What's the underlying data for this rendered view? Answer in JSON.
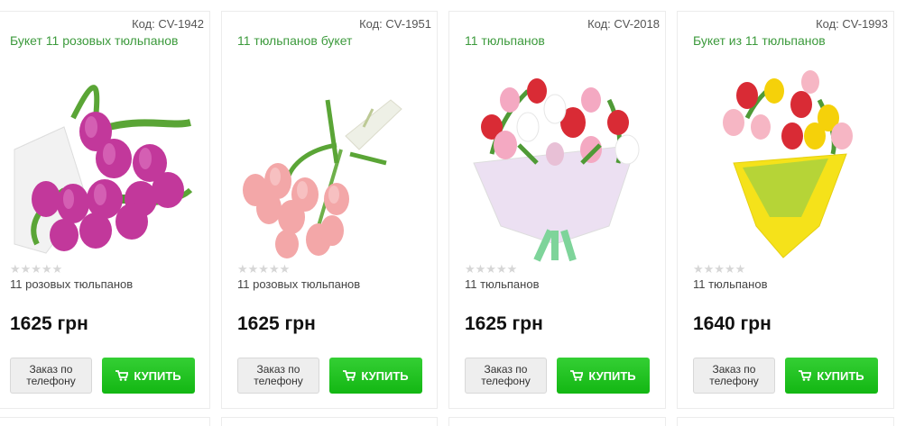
{
  "products": [
    {
      "code": "Код: CV-1942",
      "title": "Букет 11 розовых тюльпанов",
      "stars": "★★★★★",
      "subtitle": "11 розовых тюльпанов",
      "price": "1625 грн",
      "phone_label": "Заказ по телефону",
      "buy_label": "КУПИТЬ",
      "image": "pink-tulips-bouquet"
    },
    {
      "code": "Код: CV-1951",
      "title": "11 тюльпанов букет",
      "stars": "★★★★★",
      "subtitle": "11 розовых тюльпанов",
      "price": "1625 грн",
      "phone_label": "Заказ по телефону",
      "buy_label": "КУПИТЬ",
      "image": "light-pink-tulips-bouquet"
    },
    {
      "code": "Код: CV-2018",
      "title": "11 тюльпанов",
      "stars": "★★★★★",
      "subtitle": "11 тюльпанов",
      "price": "1625 грн",
      "phone_label": "Заказ по телефону",
      "buy_label": "КУПИТЬ",
      "image": "mixed-tulips-white-wrap"
    },
    {
      "code": "Код: CV-1993",
      "title": "Букет из 11 тюльпанов",
      "stars": "★★★★★",
      "subtitle": "11 тюльпанов",
      "price": "1640 грн",
      "phone_label": "Заказ по телефону",
      "buy_label": "КУПИТЬ",
      "image": "mixed-tulips-yellow-wrap"
    }
  ],
  "colors": {
    "title_green": "#3c9a3c",
    "buy_green": "#1ec01e",
    "star_grey": "#d6d6d6"
  }
}
